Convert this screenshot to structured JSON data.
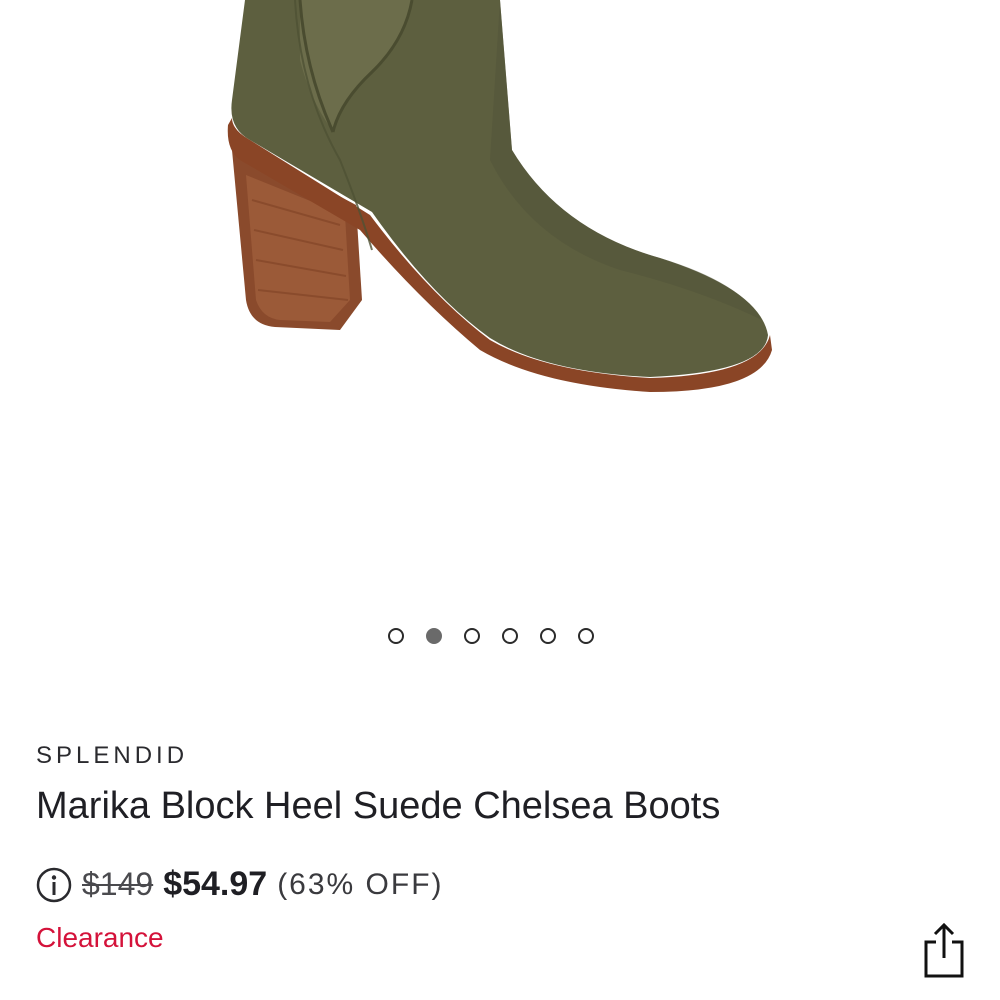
{
  "product": {
    "image_icon": "suede-chelsea-boot-image",
    "brand": "SPLENDID",
    "title": "Marika Block Heel Suede Chelsea Boots",
    "original_price": "$149",
    "sale_price": "$54.97",
    "discount": "(63% OFF)",
    "status": "Clearance"
  },
  "carousel": {
    "total": 6,
    "active_index": 1
  },
  "colors": {
    "boot_suede": "#5d5f3f",
    "heel_wood": "#8a4a2c",
    "clearance_red": "#d4123a",
    "active_dot": "#6a6a6a"
  },
  "icons": {
    "info": "info-icon",
    "share": "share-icon"
  }
}
